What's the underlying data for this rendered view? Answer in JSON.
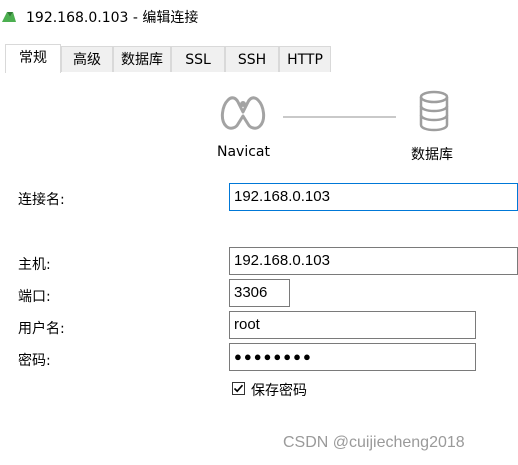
{
  "window": {
    "title": "192.168.0.103 - 编辑连接",
    "icon": "navicat-app-icon"
  },
  "tabs": [
    {
      "label": "常规",
      "active": true
    },
    {
      "label": "高级",
      "active": false
    },
    {
      "label": "数据库",
      "active": false
    },
    {
      "label": "SSL",
      "active": false
    },
    {
      "label": "SSH",
      "active": false
    },
    {
      "label": "HTTP",
      "active": false
    }
  ],
  "header": {
    "left_caption": "Navicat",
    "right_caption": "数据库",
    "left_icon": "navicat-logo-icon",
    "right_icon": "database-icon"
  },
  "form": {
    "connection_name": {
      "label": "连接名:",
      "value": "192.168.0.103"
    },
    "host": {
      "label": "主机:",
      "value": "192.168.0.103"
    },
    "port": {
      "label": "端口:",
      "value": "3306"
    },
    "username": {
      "label": "用户名:",
      "value": "root"
    },
    "password": {
      "label": "密码:",
      "value": "●●●●●●●●"
    },
    "save_password": {
      "label": "保存密码",
      "checked": true
    }
  },
  "watermark": "CSDN @cuijiecheng2018",
  "colors": {
    "focus_border": "#0078d7",
    "tab_inactive_bg": "#f0f0f0",
    "app_icon": "#4caf50"
  }
}
